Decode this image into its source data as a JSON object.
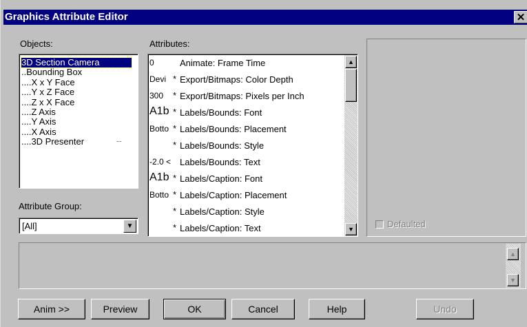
{
  "window": {
    "title": "Graphics Attribute Editor",
    "close_glyph": "✕"
  },
  "objects": {
    "label": "Objects:",
    "items": [
      {
        "text": "3D Section Camera",
        "selected": true
      },
      {
        "text": "..Bounding Box"
      },
      {
        "text": "....X x Y Face"
      },
      {
        "text": "....Y x Z Face"
      },
      {
        "text": "....Z x X Face"
      },
      {
        "text": "....Z Axis"
      },
      {
        "text": "....Y Axis"
      },
      {
        "text": "....X Axis"
      },
      {
        "text": "....3D Presenter"
      }
    ],
    "overflow_dots": "..."
  },
  "attributes": {
    "label": "Attributes:",
    "items": [
      {
        "value": "0",
        "star": "",
        "name": "Animate: Frame Time"
      },
      {
        "value": "Devi",
        "star": "*",
        "name": "Export/Bitmaps: Color Depth"
      },
      {
        "value": "300",
        "star": "*",
        "name": "Export/Bitmaps: Pixels per Inch"
      },
      {
        "value": "A1b",
        "star": "*",
        "name": "Labels/Bounds: Font",
        "font_sample": true
      },
      {
        "value": "Botto",
        "star": "*",
        "name": "Labels/Bounds: Placement"
      },
      {
        "value": "",
        "star": "*",
        "name": "Labels/Bounds: Style"
      },
      {
        "value": "-2.0 <",
        "star": "",
        "name": "Labels/Bounds: Text"
      },
      {
        "value": "A1b",
        "star": "*",
        "name": "Labels/Caption: Font",
        "font_sample": true
      },
      {
        "value": "Botto",
        "star": "*",
        "name": "Labels/Caption: Placement"
      },
      {
        "value": "",
        "star": "*",
        "name": "Labels/Caption: Style"
      },
      {
        "value": "",
        "star": "*",
        "name": "Labels/Caption: Text"
      }
    ]
  },
  "attribute_group": {
    "label": "Attribute Group:",
    "selected": "[All]"
  },
  "defaulted": {
    "label": "Defaulted",
    "checked": false,
    "enabled": false
  },
  "buttons": {
    "anim": "Anim >>",
    "preview": "Preview",
    "ok": "OK",
    "cancel": "Cancel",
    "help": "Help",
    "undo": "Undo"
  },
  "icons": {
    "scroll_up": "▲",
    "scroll_down": "▼",
    "dropdown": "▼"
  }
}
